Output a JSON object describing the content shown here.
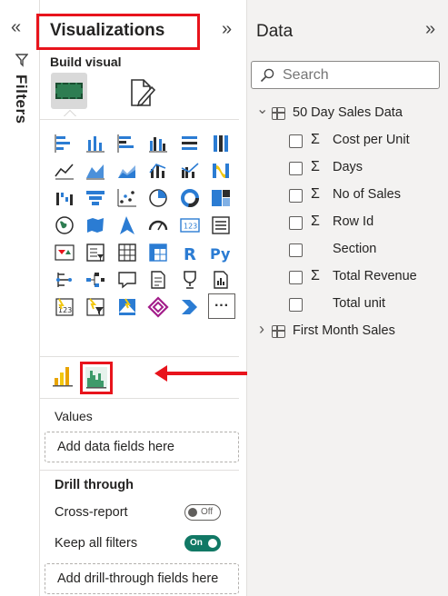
{
  "filters": {
    "label": "Filters",
    "collapse_icon": "double-chevron-left-icon"
  },
  "visualizations": {
    "title": "Visualizations",
    "expand_icon": "double-chevron-right-icon",
    "build_visual_label": "Build visual",
    "icons": [
      "stacked-bar-chart-icon",
      "stacked-column-chart-icon",
      "clustered-bar-chart-icon",
      "clustered-column-chart-icon",
      "100-stacked-bar-chart-icon",
      "100-stacked-column-chart-icon",
      "line-chart-icon",
      "area-chart-icon",
      "stacked-area-chart-icon",
      "line-and-stacked-column-chart-icon",
      "line-and-clustered-column-chart-icon",
      "ribbon-chart-icon",
      "waterfall-chart-icon",
      "funnel-chart-icon",
      "scatter-chart-icon",
      "pie-chart-icon",
      "donut-chart-icon",
      "treemap-icon",
      "map-icon",
      "filled-map-icon",
      "azure-map-icon",
      "gauge-icon",
      "card-icon",
      "multi-row-card-icon",
      "kpi-icon",
      "slicer-icon",
      "table-icon",
      "matrix-icon",
      "r-script-visual-icon",
      "python-visual-icon",
      "key-influencers-icon",
      "decomposition-tree-icon",
      "qa-icon",
      "smart-narrative-icon",
      "metrics-icon",
      "paginated-report-icon",
      "azure-kpi-icon",
      "power-automate-icon",
      "power-apps-icon",
      "power-apps-diamond-icon",
      "power-automate-arrow-icon",
      "more-visuals-icon"
    ],
    "more_label": "···",
    "custom_visuals": [
      "custom-bar-chart-icon",
      "custom-histogram-icon"
    ],
    "values_label": "Values",
    "values_placeholder": "Add data fields here",
    "drill_through_heading": "Drill through",
    "cross_report_label": "Cross-report",
    "cross_report_state": "Off",
    "keep_filters_label": "Keep all filters",
    "keep_filters_state": "On",
    "drill_placeholder": "Add drill-through fields here"
  },
  "data": {
    "title": "Data",
    "expand_icon": "double-chevron-right-icon",
    "search_placeholder": "Search",
    "tables": [
      {
        "name": "50 Day Sales Data",
        "expanded": true,
        "fields": [
          {
            "name": "Cost per Unit",
            "sigma": true
          },
          {
            "name": "Days",
            "sigma": true
          },
          {
            "name": "No of Sales",
            "sigma": true
          },
          {
            "name": "Row Id",
            "sigma": true
          },
          {
            "name": "Section",
            "sigma": false
          },
          {
            "name": "Total Revenue",
            "sigma": true
          },
          {
            "name": "Total unit",
            "sigma": false
          }
        ]
      },
      {
        "name": "First Month Sales",
        "expanded": false,
        "fields": []
      }
    ]
  },
  "colors": {
    "highlight_red": "#e8141c",
    "toggle_on": "#117865",
    "pane_bg": "#f3f2f1"
  }
}
